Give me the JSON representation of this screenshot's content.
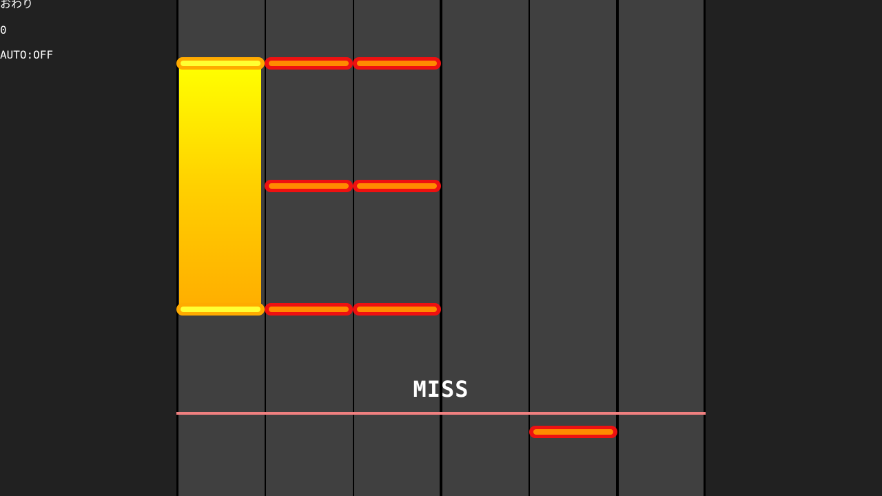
{
  "hud": {
    "status": "おわり",
    "score": "0",
    "auto": "AUTO:OFF"
  },
  "judgement": "MISS",
  "colors": {
    "background": "#212121",
    "lane": "#404040",
    "lane_divider": "#000000",
    "judge_line": "#f08080",
    "tap_note_outer": "#ee1111",
    "tap_note_inner": "#ff8a00",
    "hold_note_outer": "#ffab00",
    "hold_note_inner": "#ffff33",
    "hold_body_top": "#ffff00",
    "hold_body_bottom": "#ffae00"
  },
  "lanes": [
    1,
    2,
    3,
    4,
    5,
    6
  ]
}
